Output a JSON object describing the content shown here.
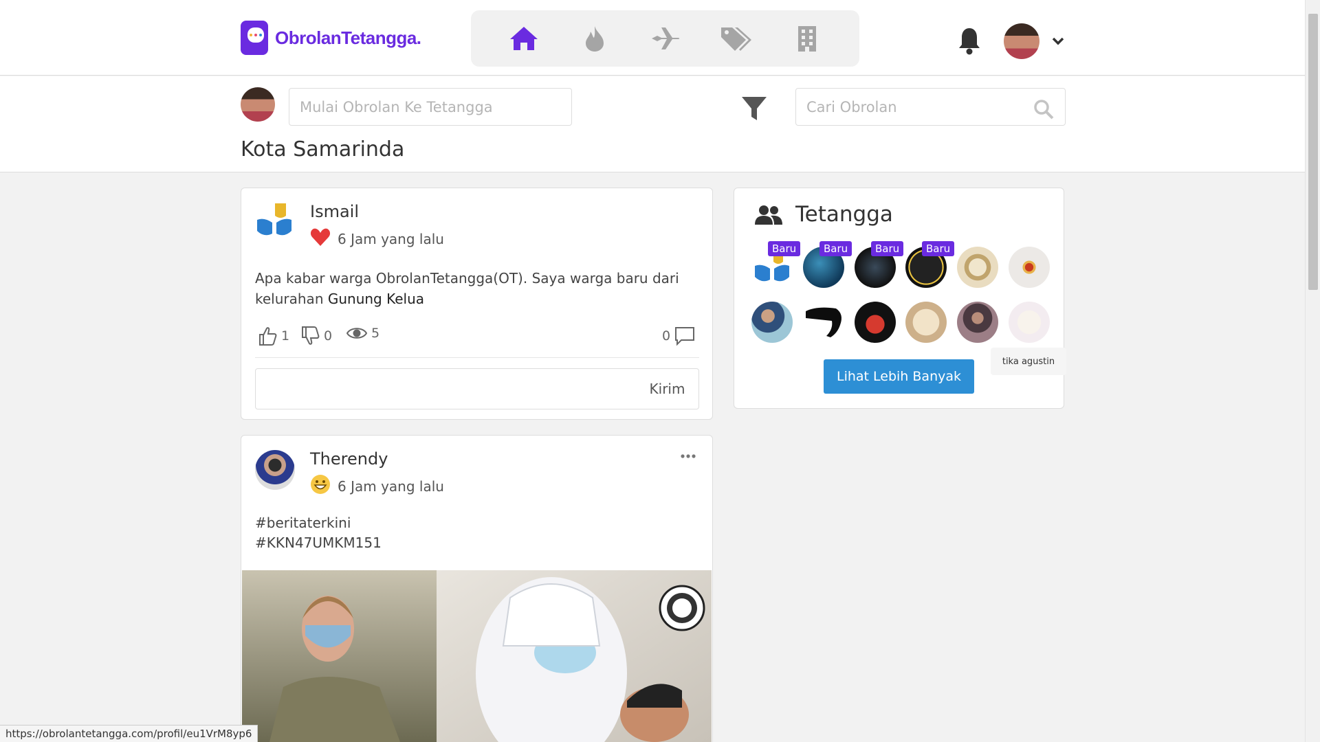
{
  "app": {
    "brand": "ObrolanTetangga.",
    "colors": {
      "brand": "#6a2be0",
      "accent_blue": "#2d8fd5",
      "badge": "#6a2be0"
    }
  },
  "nav": {
    "items": [
      {
        "name": "home",
        "icon": "home-icon",
        "active": true
      },
      {
        "name": "trending",
        "icon": "fire-icon"
      },
      {
        "name": "travel",
        "icon": "plane-icon"
      },
      {
        "name": "deals",
        "icon": "tags-icon"
      },
      {
        "name": "buildings",
        "icon": "building-icon"
      }
    ]
  },
  "composer": {
    "placeholder": "Mulai Obrolan Ke Tetangga",
    "search_placeholder": "Cari Obrolan"
  },
  "page": {
    "title": "Kota Samarinda"
  },
  "posts": [
    {
      "author": "Ismail",
      "time": "6 Jam yang lalu",
      "mood_icon": "heart-icon",
      "text": "Apa kabar warga ObrolanTetangga(OT). Saya warga baru dari kelurahan ",
      "text_link": "Gunung Kelua",
      "likes": "1",
      "dislikes": "0",
      "views": "5",
      "comments": "0",
      "send_label": "Kirim"
    },
    {
      "author": "Therendy",
      "time": "6 Jam yang lalu",
      "mood_icon": "grinning-face-icon",
      "line1": "#beritaterkini",
      "line2": "#KKN47UMKM151"
    }
  ],
  "neighbours": {
    "title": "Tetangga",
    "badge_label": "Baru",
    "more_label": "Lihat Lebih Banyak",
    "tooltip": "tika agustin"
  },
  "status_url": "https://obrolantetangga.com/profil/eu1VrM8yp6"
}
